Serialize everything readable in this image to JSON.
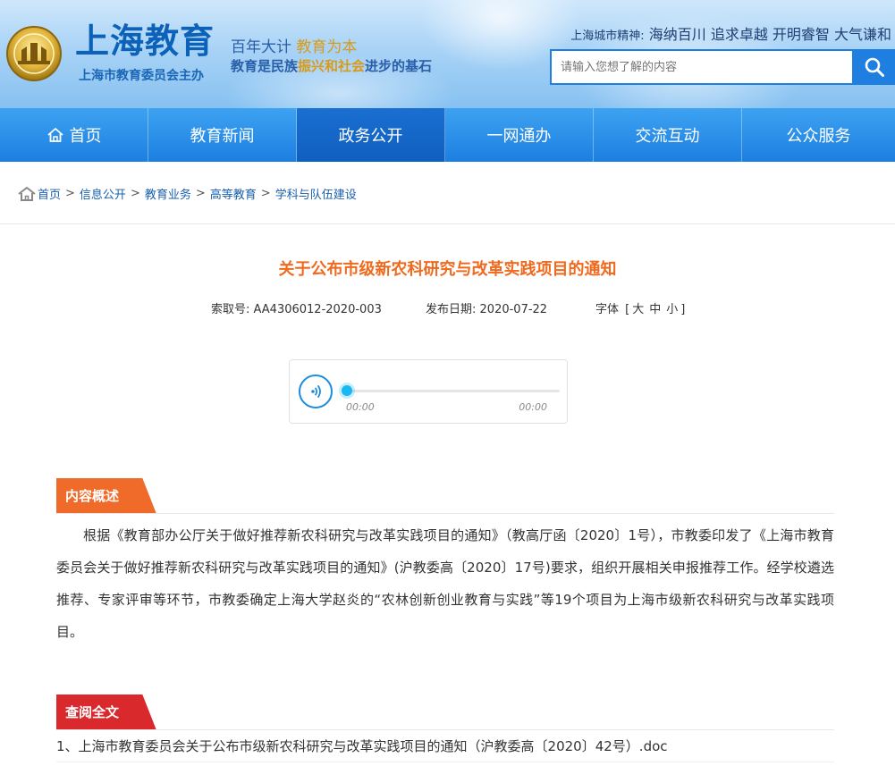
{
  "header": {
    "site_title": "上海教育",
    "site_subtitle": "上海市教育委员会主办",
    "slogan_line1_a": "百年大计",
    "slogan_line1_b": "教育为本",
    "slogan_line2_a": "教育是民族",
    "slogan_line2_b": "振兴和社会",
    "slogan_line2_c": "进步的基石",
    "spirit_label": "上海城市精神:",
    "spirit_text": "海纳百川 追求卓越 开明睿智 大气谦和",
    "search_placeholder": "请输入您想了解的内容",
    "colors": {
      "primary": "#1e7fe0",
      "accent": "#d89a1a"
    }
  },
  "nav": {
    "items": [
      {
        "label": "首页",
        "icon": "home-icon"
      },
      {
        "label": "教育新闻"
      },
      {
        "label": "政务公开",
        "active": true
      },
      {
        "label": "一网通办"
      },
      {
        "label": "交流互动"
      },
      {
        "label": "公众服务"
      }
    ]
  },
  "breadcrumb": {
    "items": [
      "首页",
      "信息公开",
      "教育业务",
      "高等教育",
      "学科与队伍建设"
    ],
    "separator": ">"
  },
  "article": {
    "title": "关于公布市级新农科研究与改革实践项目的通知",
    "index_label": "索取号:",
    "index_value": "AA4306012-2020-003",
    "date_label": "发布日期:",
    "date_value": "2020-07-22",
    "font_label": "字体",
    "font_open": "[",
    "font_large": "大",
    "font_medium": "中",
    "font_small": "小",
    "font_close": "]"
  },
  "player": {
    "current_time": "00:00",
    "duration": "00:00",
    "progress": 0
  },
  "summary": {
    "heading": "内容概述",
    "text": "根据《教育部办公厅关于做好推荐新农科研究与改革实践项目的通知》（教高厅函〔2020〕1号），市教委印发了《上海市教育委员会关于做好推荐新农科研究与改革实践项目的通知》(沪教委高〔2020〕17号)要求，组织开展相关申报推荐工作。经学校遴选推荐、专家评审等环节，市教委确定上海大学赵炎的“农林创新创业教育与实践”等19个项目为上海市级新农科研究与改革实践项目。"
  },
  "fulltext": {
    "heading": "查阅全文",
    "attachments": [
      "1、上海市教育委员会关于公布市级新农科研究与改革实践项目的通知（沪教委高〔2020〕42号）.doc"
    ]
  }
}
